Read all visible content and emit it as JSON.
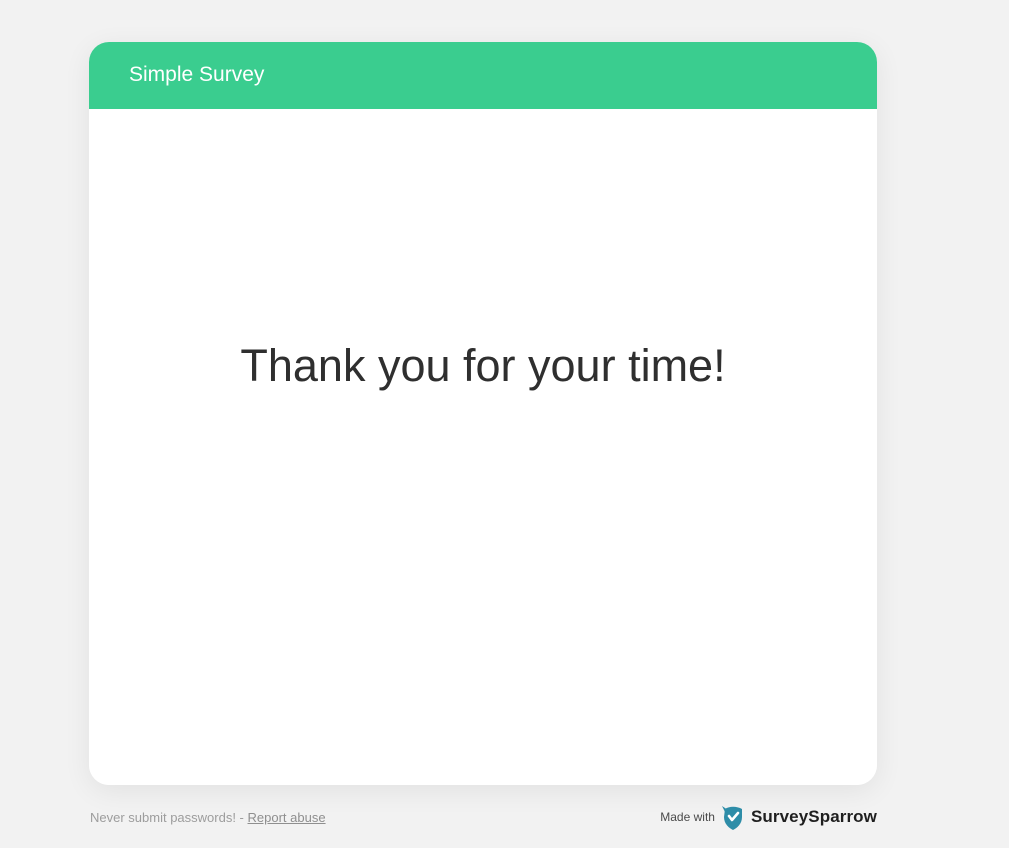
{
  "header": {
    "title": "Simple Survey"
  },
  "main": {
    "message": "Thank you for your time!"
  },
  "footer": {
    "warning_text": "Never submit passwords! -",
    "report_link": "Report abuse",
    "made_with": "Made with",
    "brand": "SurveySparrow",
    "brand_icon": "surveysparrow-logo-icon"
  },
  "colors": {
    "header_bg": "#3acd8f",
    "page_bg": "#f2f2f2",
    "card_bg": "#ffffff",
    "brand_icon": "#2e8da8"
  }
}
